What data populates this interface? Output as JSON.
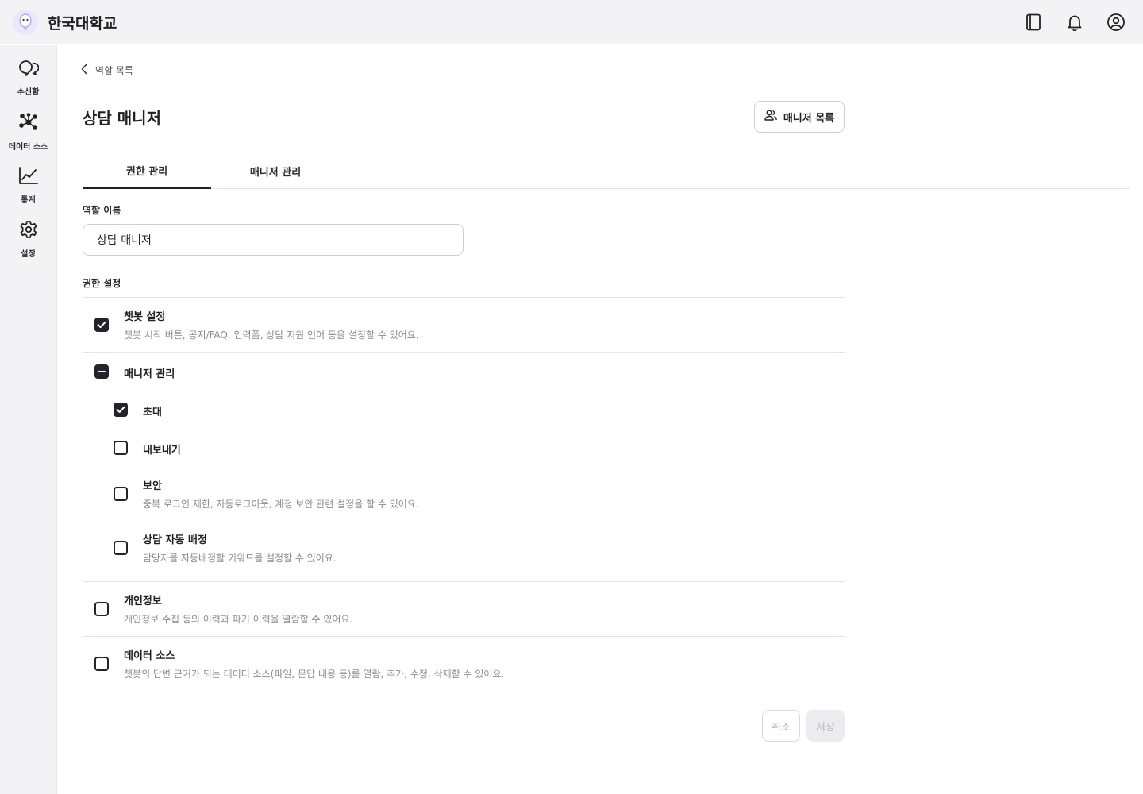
{
  "header": {
    "brand_name": "한국대학교",
    "icons": [
      "book-icon",
      "bell-icon",
      "user-circle-icon"
    ]
  },
  "sidebar": {
    "items": [
      {
        "label": "수신함",
        "icon": "inbox-chat-icon"
      },
      {
        "label": "데이터 소스",
        "icon": "network-nodes-icon"
      },
      {
        "label": "통계",
        "icon": "line-chart-icon"
      },
      {
        "label": "설정",
        "icon": "gear-icon"
      }
    ]
  },
  "main": {
    "breadcrumb": "역할 목록",
    "title": "상담 매니저",
    "manager_list_button": "매니저 목록",
    "tabs": [
      {
        "label": "권한 관리",
        "active": true
      },
      {
        "label": "매니저 관리",
        "active": false
      }
    ],
    "role_name_label": "역할 이름",
    "role_name_value": "상담 매니저",
    "permissions_label": "권한 설정",
    "permissions": {
      "chatbot": {
        "title": "챗봇 설정",
        "desc": "챗봇 시작 버튼, 공지/FAQ, 입력폼, 상담 지원 언어 등을 설정할 수 있어요.",
        "state": "checked"
      },
      "manager": {
        "title": "매니저 관리",
        "state": "indeterminate"
      },
      "invite": {
        "title": "초대",
        "state": "checked"
      },
      "export": {
        "title": "내보내기",
        "state": "unchecked"
      },
      "security": {
        "title": "보안",
        "desc": "중복 로그인 제한, 자동로그아웃, 계정 보안 관련 설정을 할 수 있어요.",
        "state": "unchecked"
      },
      "auto_assign": {
        "title": "상담 자동 배정",
        "desc": "담당자를 자동배정할 키워드를 설정할 수 있어요.",
        "state": "unchecked"
      },
      "privacy": {
        "title": "개인정보",
        "desc": "개인정보 수집 등의 이력과 파기 이력을 열람할 수 있어요.",
        "state": "unchecked"
      },
      "datasource": {
        "title": "데이터 소스",
        "desc": "챗봇의 답변 근거가 되는 데이터 소스(파일, 문답 내용 등)를 열람, 추가, 수정, 삭제할 수 있어요.",
        "state": "unchecked"
      }
    },
    "cancel_label": "취소",
    "save_label": "저장"
  }
}
